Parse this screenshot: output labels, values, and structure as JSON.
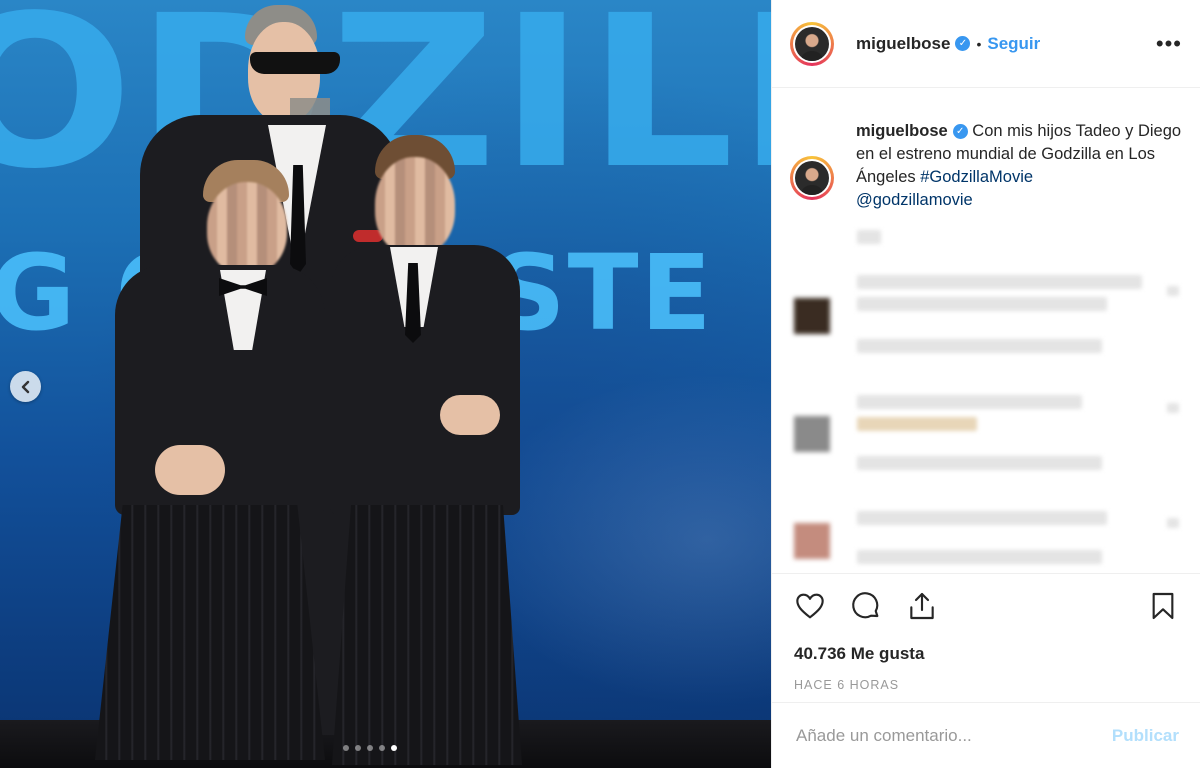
{
  "post": {
    "username": "miguelbose",
    "follow_label": "Seguir",
    "more_label": "•••",
    "separator": "•"
  },
  "caption": {
    "username": "miguelbose",
    "text": "Con mis hijos Tadeo y Diego en el estreno mundial de Godzilla en Los Ángeles",
    "hashtag": "#GodzillaMovie",
    "mention": "@godzillamovie"
  },
  "photo": {
    "carousel_dots": 5,
    "active_dot": 4
  },
  "stats": {
    "likes": "40.736 Me gusta",
    "time": "HACE 6 HORAS"
  },
  "comment_box": {
    "placeholder": "Añade un comentario...",
    "publish_label": "Publicar"
  },
  "colors": {
    "accent": "#3897f0",
    "link": "#003569",
    "publish_disabled": "#b2dffc"
  }
}
